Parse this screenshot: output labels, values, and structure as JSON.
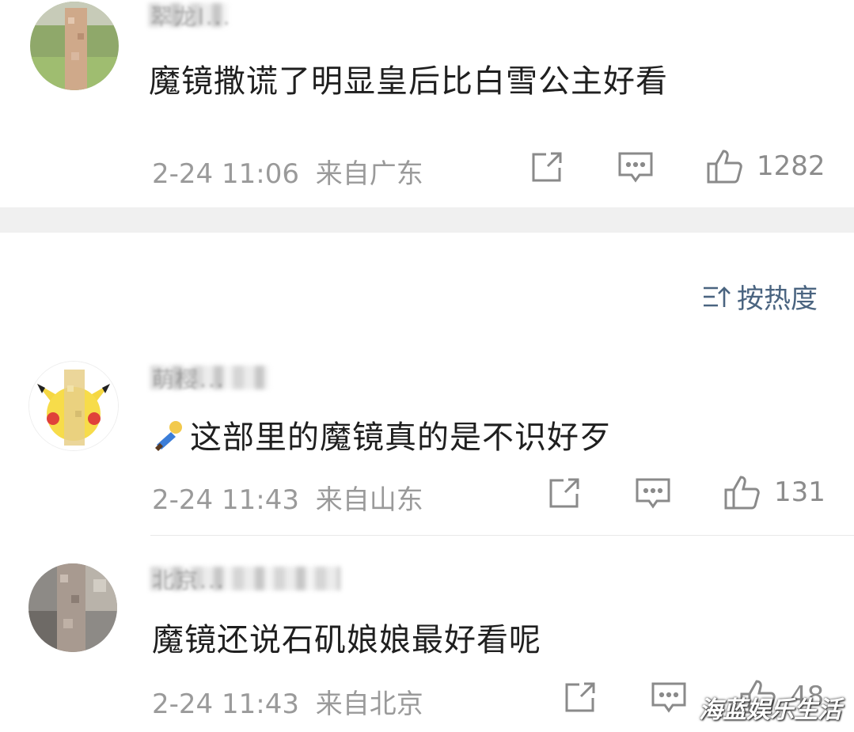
{
  "comments": [
    {
      "username": "翠龙l...",
      "text": "魔镜撒谎了明显皇后比白雪公主好看",
      "time": "2-24 11:06",
      "location": "来自广东",
      "likes": "1282"
    },
    {
      "username": "萌樱...",
      "emoji": "sleeping-person-icon",
      "text": "这部里的魔镜真的是不识好歹",
      "time": "2-24 11:43",
      "location": "来自山东",
      "likes": "131"
    },
    {
      "username": "北京...",
      "text": "魔镜还说石矶娘娘最好看呢",
      "time": "2-24 11:43",
      "location": "来自北京",
      "likes": "48"
    }
  ],
  "sort": {
    "label": "按热度",
    "icon": "sort-icon"
  },
  "watermark": "海蓝娱乐生活",
  "colors": {
    "accent": "#4a6480",
    "meta": "#9a9a9a",
    "divider_band": "#f0f0f0"
  }
}
